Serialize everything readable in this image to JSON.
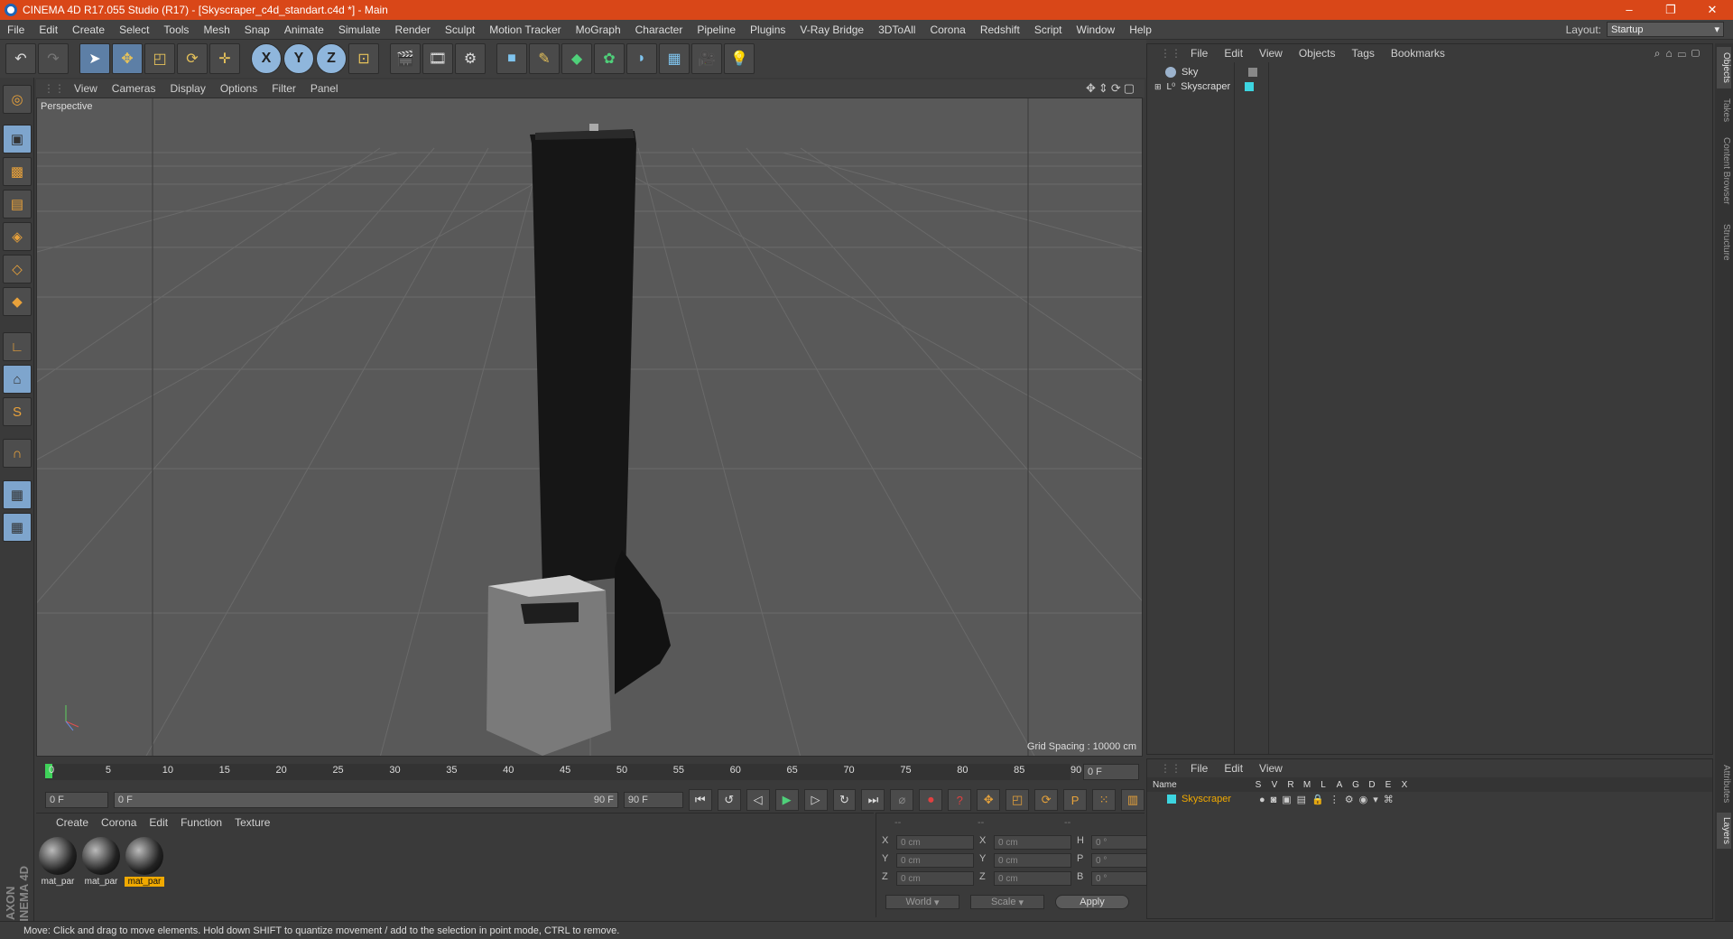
{
  "window": {
    "title": "CINEMA 4D R17.055 Studio (R17) - [Skyscraper_c4d_standart.c4d *] - Main",
    "controls": [
      "–",
      "❐",
      "✕"
    ]
  },
  "menubar": {
    "items": [
      "File",
      "Edit",
      "Create",
      "Select",
      "Tools",
      "Mesh",
      "Snap",
      "Animate",
      "Simulate",
      "Render",
      "Sculpt",
      "Motion Tracker",
      "MoGraph",
      "Character",
      "Pipeline",
      "Plugins",
      "V-Ray Bridge",
      "3DToAll",
      "Corona",
      "Redshift",
      "Script",
      "Window",
      "Help"
    ],
    "layout_label": "Layout:",
    "layout_value": "Startup"
  },
  "viewport": {
    "menu": [
      "View",
      "Cameras",
      "Display",
      "Options",
      "Filter",
      "Panel"
    ],
    "label": "Perspective",
    "grid_spacing": "Grid Spacing : 10000 cm"
  },
  "timeline": {
    "ticks": [
      "0",
      "5",
      "10",
      "15",
      "20",
      "25",
      "30",
      "35",
      "40",
      "45",
      "50",
      "55",
      "60",
      "65",
      "70",
      "75",
      "80",
      "85",
      "90"
    ],
    "current_frame": "0 F",
    "start_field": "0 F",
    "range_left": "0 F",
    "range_right": "90 F",
    "end_field": "90 F"
  },
  "material_manager": {
    "menu": [
      "Create",
      "Corona",
      "Edit",
      "Function",
      "Texture"
    ],
    "materials": [
      {
        "name": "mat_par",
        "selected": false
      },
      {
        "name": "mat_par",
        "selected": false
      },
      {
        "name": "mat_par",
        "selected": true
      }
    ]
  },
  "coordinates": {
    "headers": [
      "--",
      "--",
      "--"
    ],
    "rows": [
      {
        "a": "X",
        "v1": "0 cm",
        "b": "X",
        "v2": "0 cm",
        "c": "H",
        "v3": "0 °"
      },
      {
        "a": "Y",
        "v1": "0 cm",
        "b": "Y",
        "v2": "0 cm",
        "c": "P",
        "v3": "0 °"
      },
      {
        "a": "Z",
        "v1": "0 cm",
        "b": "Z",
        "v2": "0 cm",
        "c": "B",
        "v3": "0 °"
      }
    ],
    "world": "World",
    "scale": "Scale",
    "apply": "Apply"
  },
  "object_manager": {
    "menu": [
      "File",
      "Edit",
      "View",
      "Objects",
      "Tags",
      "Bookmarks"
    ],
    "objects": [
      {
        "name": "Sky"
      },
      {
        "name": "Skyscraper"
      }
    ]
  },
  "layer_manager": {
    "menu": [
      "File",
      "Edit",
      "View"
    ],
    "columns": [
      "Name",
      "S",
      "V",
      "R",
      "M",
      "L",
      "A",
      "G",
      "D",
      "E",
      "X"
    ],
    "layers": [
      {
        "name": "Skyscraper"
      }
    ]
  },
  "right_tabs": [
    "Objects",
    "Takes",
    "Content Browser",
    "Structure",
    "Attributes",
    "Layers"
  ],
  "logo": "MAXON CINEMA 4D",
  "status": "Move: Click and drag to move elements. Hold down SHIFT to quantize movement / add to the selection in point mode, CTRL to remove.",
  "colors": {
    "accent": "#d94718",
    "selection": "#f0a900",
    "layer": "#3dd5e0"
  }
}
